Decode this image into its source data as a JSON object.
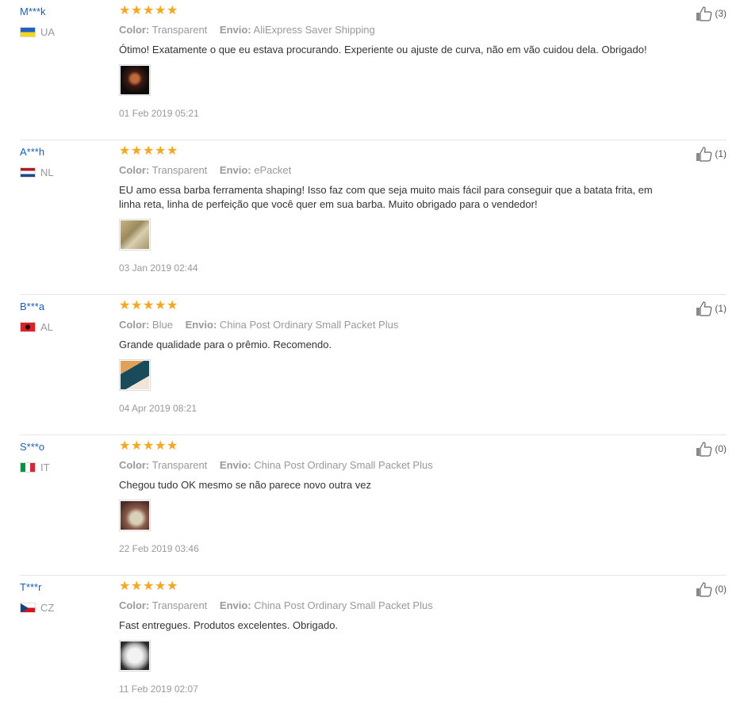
{
  "reviews": [
    {
      "user": "M***k",
      "country": "UA",
      "color_label": "Color:",
      "color": "Transparent",
      "shipping_label": "Envio:",
      "shipping": "AliExpress Saver Shipping",
      "text": "Ótimo! Exatamente o que eu estava procurando. Experiente ou ajuste de curva, não em vão cuidou dela. Obrigado!",
      "date": "01 Feb 2019 05:21",
      "likes": "(3)",
      "rating": 5
    },
    {
      "user": "A***h",
      "country": "NL",
      "color_label": "Color:",
      "color": "Transparent",
      "shipping_label": "Envio:",
      "shipping": "ePacket",
      "text": "EU amo essa barba ferramenta shaping! Isso faz com que seja muito mais fácil para conseguir que a batata frita, em linha reta, linha de perfeição que você quer em sua barba. Muito obrigado para o vendedor!",
      "date": "03 Jan 2019 02:44",
      "likes": "(1)",
      "rating": 5
    },
    {
      "user": "B***a",
      "country": "AL",
      "color_label": "Color:",
      "color": "Blue",
      "shipping_label": "Envio:",
      "shipping": "China Post Ordinary Small Packet Plus",
      "text": "Grande qualidade para o prêmio. Recomendo.",
      "date": "04 Apr 2019 08:21",
      "likes": "(1)",
      "rating": 5
    },
    {
      "user": "S***o",
      "country": "IT",
      "color_label": "Color:",
      "color": "Transparent",
      "shipping_label": "Envio:",
      "shipping": "China Post Ordinary Small Packet Plus",
      "text": "Chegou tudo OK mesmo se não parece novo outra vez",
      "date": "22 Feb 2019 03:46",
      "likes": "(0)",
      "rating": 5
    },
    {
      "user": "T***r",
      "country": "CZ",
      "color_label": "Color:",
      "color": "Transparent",
      "shipping_label": "Envio:",
      "shipping": "China Post Ordinary Small Packet Plus",
      "text": "Fast entregues. Produtos excelentes. Obrigado.",
      "date": "11 Feb 2019 02:07",
      "likes": "(0)",
      "rating": 5
    }
  ],
  "colors": {
    "star": "#f5a623",
    "username": "#1a5fb4",
    "muted": "#999999"
  },
  "icons": {
    "star": "star-icon",
    "like": "thumbs-up-icon"
  }
}
